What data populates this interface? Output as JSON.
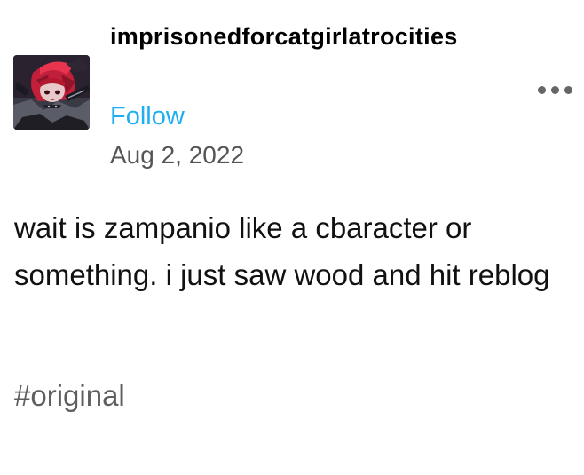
{
  "post": {
    "username": "imprisonedforcatgirlatrocities",
    "follow_label": "Follow",
    "date": "Aug 2, 2022",
    "body": "wait is zampanio like a cbaracter or something. i just saw wood and hit reblog",
    "tags": [
      "#original"
    ],
    "more_icon": "more-options-icon"
  },
  "colors": {
    "follow": "#1eaef2",
    "date": "#555555",
    "tag": "#5e5e5e",
    "text": "#111111"
  }
}
